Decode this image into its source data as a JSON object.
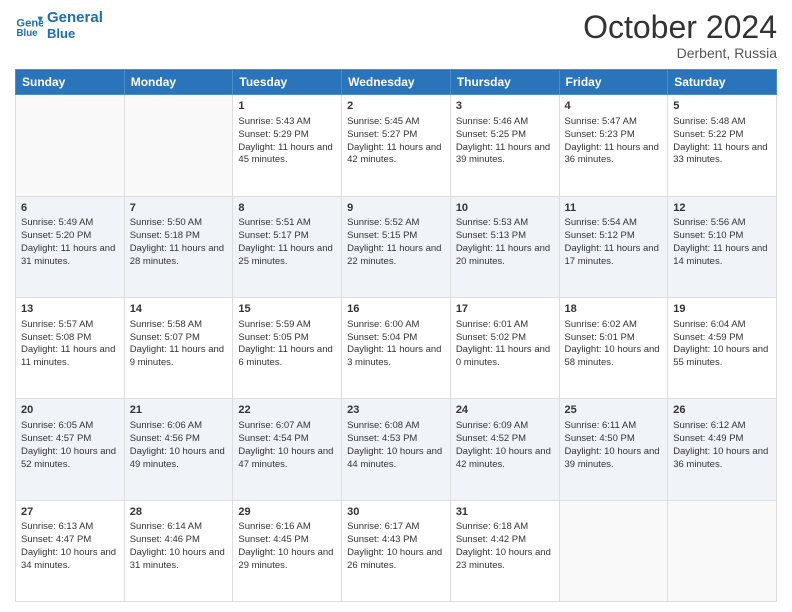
{
  "header": {
    "logo_line1": "General",
    "logo_line2": "Blue",
    "month": "October 2024",
    "location": "Derbent, Russia"
  },
  "weekdays": [
    "Sunday",
    "Monday",
    "Tuesday",
    "Wednesday",
    "Thursday",
    "Friday",
    "Saturday"
  ],
  "rows": [
    [
      {
        "day": "",
        "sunrise": "",
        "sunset": "",
        "daylight": ""
      },
      {
        "day": "",
        "sunrise": "",
        "sunset": "",
        "daylight": ""
      },
      {
        "day": "1",
        "sunrise": "Sunrise: 5:43 AM",
        "sunset": "Sunset: 5:29 PM",
        "daylight": "Daylight: 11 hours and 45 minutes."
      },
      {
        "day": "2",
        "sunrise": "Sunrise: 5:45 AM",
        "sunset": "Sunset: 5:27 PM",
        "daylight": "Daylight: 11 hours and 42 minutes."
      },
      {
        "day": "3",
        "sunrise": "Sunrise: 5:46 AM",
        "sunset": "Sunset: 5:25 PM",
        "daylight": "Daylight: 11 hours and 39 minutes."
      },
      {
        "day": "4",
        "sunrise": "Sunrise: 5:47 AM",
        "sunset": "Sunset: 5:23 PM",
        "daylight": "Daylight: 11 hours and 36 minutes."
      },
      {
        "day": "5",
        "sunrise": "Sunrise: 5:48 AM",
        "sunset": "Sunset: 5:22 PM",
        "daylight": "Daylight: 11 hours and 33 minutes."
      }
    ],
    [
      {
        "day": "6",
        "sunrise": "Sunrise: 5:49 AM",
        "sunset": "Sunset: 5:20 PM",
        "daylight": "Daylight: 11 hours and 31 minutes."
      },
      {
        "day": "7",
        "sunrise": "Sunrise: 5:50 AM",
        "sunset": "Sunset: 5:18 PM",
        "daylight": "Daylight: 11 hours and 28 minutes."
      },
      {
        "day": "8",
        "sunrise": "Sunrise: 5:51 AM",
        "sunset": "Sunset: 5:17 PM",
        "daylight": "Daylight: 11 hours and 25 minutes."
      },
      {
        "day": "9",
        "sunrise": "Sunrise: 5:52 AM",
        "sunset": "Sunset: 5:15 PM",
        "daylight": "Daylight: 11 hours and 22 minutes."
      },
      {
        "day": "10",
        "sunrise": "Sunrise: 5:53 AM",
        "sunset": "Sunset: 5:13 PM",
        "daylight": "Daylight: 11 hours and 20 minutes."
      },
      {
        "day": "11",
        "sunrise": "Sunrise: 5:54 AM",
        "sunset": "Sunset: 5:12 PM",
        "daylight": "Daylight: 11 hours and 17 minutes."
      },
      {
        "day": "12",
        "sunrise": "Sunrise: 5:56 AM",
        "sunset": "Sunset: 5:10 PM",
        "daylight": "Daylight: 11 hours and 14 minutes."
      }
    ],
    [
      {
        "day": "13",
        "sunrise": "Sunrise: 5:57 AM",
        "sunset": "Sunset: 5:08 PM",
        "daylight": "Daylight: 11 hours and 11 minutes."
      },
      {
        "day": "14",
        "sunrise": "Sunrise: 5:58 AM",
        "sunset": "Sunset: 5:07 PM",
        "daylight": "Daylight: 11 hours and 9 minutes."
      },
      {
        "day": "15",
        "sunrise": "Sunrise: 5:59 AM",
        "sunset": "Sunset: 5:05 PM",
        "daylight": "Daylight: 11 hours and 6 minutes."
      },
      {
        "day": "16",
        "sunrise": "Sunrise: 6:00 AM",
        "sunset": "Sunset: 5:04 PM",
        "daylight": "Daylight: 11 hours and 3 minutes."
      },
      {
        "day": "17",
        "sunrise": "Sunrise: 6:01 AM",
        "sunset": "Sunset: 5:02 PM",
        "daylight": "Daylight: 11 hours and 0 minutes."
      },
      {
        "day": "18",
        "sunrise": "Sunrise: 6:02 AM",
        "sunset": "Sunset: 5:01 PM",
        "daylight": "Daylight: 10 hours and 58 minutes."
      },
      {
        "day": "19",
        "sunrise": "Sunrise: 6:04 AM",
        "sunset": "Sunset: 4:59 PM",
        "daylight": "Daylight: 10 hours and 55 minutes."
      }
    ],
    [
      {
        "day": "20",
        "sunrise": "Sunrise: 6:05 AM",
        "sunset": "Sunset: 4:57 PM",
        "daylight": "Daylight: 10 hours and 52 minutes."
      },
      {
        "day": "21",
        "sunrise": "Sunrise: 6:06 AM",
        "sunset": "Sunset: 4:56 PM",
        "daylight": "Daylight: 10 hours and 49 minutes."
      },
      {
        "day": "22",
        "sunrise": "Sunrise: 6:07 AM",
        "sunset": "Sunset: 4:54 PM",
        "daylight": "Daylight: 10 hours and 47 minutes."
      },
      {
        "day": "23",
        "sunrise": "Sunrise: 6:08 AM",
        "sunset": "Sunset: 4:53 PM",
        "daylight": "Daylight: 10 hours and 44 minutes."
      },
      {
        "day": "24",
        "sunrise": "Sunrise: 6:09 AM",
        "sunset": "Sunset: 4:52 PM",
        "daylight": "Daylight: 10 hours and 42 minutes."
      },
      {
        "day": "25",
        "sunrise": "Sunrise: 6:11 AM",
        "sunset": "Sunset: 4:50 PM",
        "daylight": "Daylight: 10 hours and 39 minutes."
      },
      {
        "day": "26",
        "sunrise": "Sunrise: 6:12 AM",
        "sunset": "Sunset: 4:49 PM",
        "daylight": "Daylight: 10 hours and 36 minutes."
      }
    ],
    [
      {
        "day": "27",
        "sunrise": "Sunrise: 6:13 AM",
        "sunset": "Sunset: 4:47 PM",
        "daylight": "Daylight: 10 hours and 34 minutes."
      },
      {
        "day": "28",
        "sunrise": "Sunrise: 6:14 AM",
        "sunset": "Sunset: 4:46 PM",
        "daylight": "Daylight: 10 hours and 31 minutes."
      },
      {
        "day": "29",
        "sunrise": "Sunrise: 6:16 AM",
        "sunset": "Sunset: 4:45 PM",
        "daylight": "Daylight: 10 hours and 29 minutes."
      },
      {
        "day": "30",
        "sunrise": "Sunrise: 6:17 AM",
        "sunset": "Sunset: 4:43 PM",
        "daylight": "Daylight: 10 hours and 26 minutes."
      },
      {
        "day": "31",
        "sunrise": "Sunrise: 6:18 AM",
        "sunset": "Sunset: 4:42 PM",
        "daylight": "Daylight: 10 hours and 23 minutes."
      },
      {
        "day": "",
        "sunrise": "",
        "sunset": "",
        "daylight": ""
      },
      {
        "day": "",
        "sunrise": "",
        "sunset": "",
        "daylight": ""
      }
    ]
  ]
}
